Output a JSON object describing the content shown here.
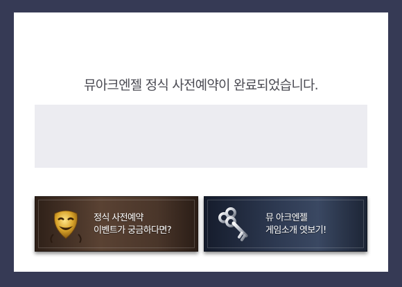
{
  "message": "뮤아크엔젤 정식 사전예약이 완료되었습니다.",
  "banners": [
    {
      "line1": "정식 사전예약",
      "line2": "이벤트가 궁금하다면?",
      "icon": "theater-mask-icon"
    },
    {
      "line1": "뮤 아크엔젤",
      "line2": "게임소개 엿보기!",
      "icon": "key-icon"
    }
  ],
  "colors": {
    "backdrop": "#363a55",
    "panel": "#ffffff",
    "infobox": "#ececf1",
    "banner_brown": "#5a4233",
    "banner_blue": "#2e3a52"
  }
}
